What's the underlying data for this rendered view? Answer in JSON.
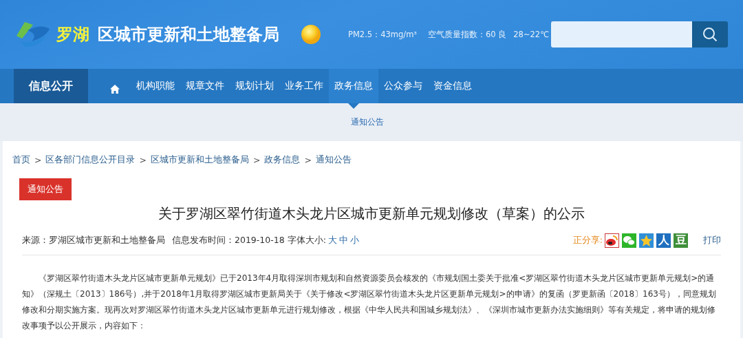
{
  "header": {
    "logo": [
      {
        "text": "罗湖",
        "kind": "district"
      },
      {
        "text": "区城市更新和土地整备局",
        "kind": "bureau"
      }
    ],
    "weather": {
      "pm25": "PM2.5：43mg/m³",
      "aqi": "空气质量指数：60 良",
      "temperature": "28~22℃"
    }
  },
  "nav": {
    "section": "信息公开",
    "items": [
      {
        "kind": "home",
        "selected": false
      },
      {
        "kind": "text",
        "label": "机构职能",
        "selected": false
      },
      {
        "kind": "text",
        "label": "规章文件",
        "selected": false
      },
      {
        "kind": "text",
        "label": "规划计划",
        "selected": false
      },
      {
        "kind": "text",
        "label": "业务工作",
        "selected": false
      },
      {
        "kind": "text",
        "label": "政务信息",
        "selected": true
      },
      {
        "kind": "text",
        "label": "公众参与",
        "selected": false
      },
      {
        "kind": "text",
        "label": "资金信息",
        "selected": false
      }
    ]
  },
  "subnav": [
    "通知公告"
  ],
  "breadcrumb": {
    "separator": ">",
    "items": [
      "首页",
      "区各部门信息公开目录",
      "区城市更新和土地整备局",
      "政务信息",
      "通知公告"
    ]
  },
  "article": {
    "tag": "通知公告",
    "title": "关于罗湖区翠竹街道木头龙片区城市更新单元规划修改（草案）的公示",
    "source": "来源：罗湖区城市更新和土地整备局",
    "date": "信息发布时间：2019-10-18",
    "font_size_label": "字体大小:",
    "font_sizes": [
      "大",
      "中",
      "小"
    ],
    "share_label": "正分享:",
    "share": [
      {
        "kind": "weibo"
      },
      {
        "kind": "wechat"
      },
      {
        "kind": "qzone"
      },
      {
        "kind": "renren",
        "glyph": "人"
      },
      {
        "kind": "douban",
        "glyph": "豆"
      }
    ],
    "print": "打印",
    "body": "《罗湖区翠竹街道木头龙片区城市更新单元规划》已于2013年4月取得深圳市规划和自然资源委员会核发的《市规划国土委关于批准<罗湖区翠竹街道木头龙片区城市更新单元规划>的通知》（深规土〔2013〕186号）,并于2018年1月取得罗湖区城市更新局关于《关于修改<罗湖区翠竹街道木头龙片区更新单元规划>的申请》的复函（罗更新函〔2018〕163号），同意规划修改和分期实施方案。现再次对罗湖区翠竹街道木头龙片区城市更新单元进行规划修改，根据《中华人民共和国城乡规划法》、《深圳市城市更新办法实施细则》等有关规定，将申请的规划修改事项予以公开展示，内容如下："
  }
}
